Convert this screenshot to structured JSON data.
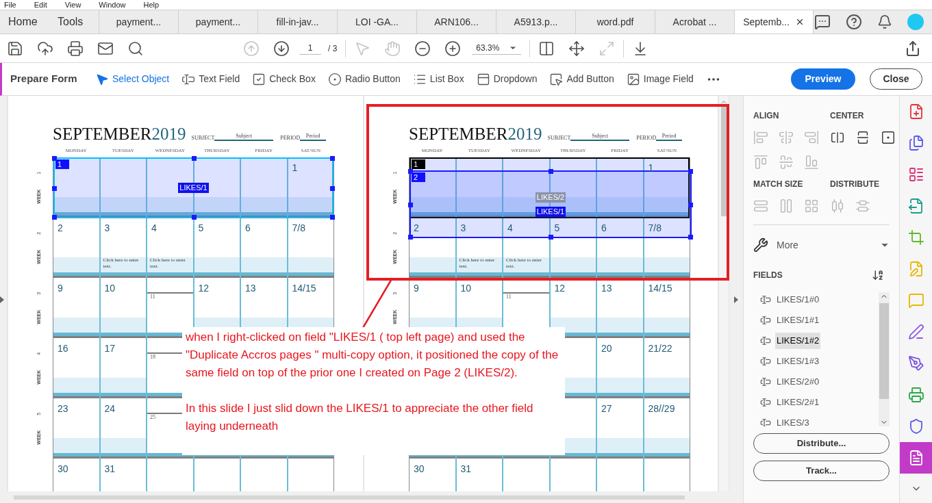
{
  "menu": [
    "File",
    "Edit",
    "View",
    "Window",
    "Help"
  ],
  "tabs": [
    {
      "label": "Home",
      "kind": "nav",
      "selected": false
    },
    {
      "label": "Tools",
      "kind": "nav",
      "selected": false
    },
    {
      "label": "payment...",
      "kind": "doc",
      "selected": false
    },
    {
      "label": "payment...",
      "kind": "doc",
      "selected": false
    },
    {
      "label": "fill-in-jav...",
      "kind": "doc",
      "selected": false
    },
    {
      "label": "LOI -GA...",
      "kind": "doc",
      "selected": false
    },
    {
      "label": "ARN106...",
      "kind": "doc",
      "selected": false
    },
    {
      "label": "A5913.p...",
      "kind": "doc",
      "selected": false
    },
    {
      "label": "word.pdf",
      "kind": "doc",
      "selected": false
    },
    {
      "label": "Acrobat ...",
      "kind": "doc",
      "selected": false
    },
    {
      "label": "Septemb...",
      "kind": "doc",
      "selected": true
    }
  ],
  "toolbar": {
    "left": [
      {
        "kind": "save",
        "disabled": false
      },
      {
        "kind": "upload",
        "disabled": false
      },
      {
        "kind": "print",
        "disabled": false
      },
      {
        "kind": "mail",
        "disabled": false
      },
      {
        "kind": "find",
        "disabled": false
      }
    ],
    "nav": [
      {
        "kind": "up",
        "disabled": true
      },
      {
        "kind": "down",
        "disabled": false
      }
    ],
    "page": {
      "value": "1",
      "total": "/ 3"
    },
    "view": [
      {
        "kind": "pointer",
        "disabled": true
      },
      {
        "kind": "hand",
        "disabled": true
      },
      {
        "kind": "zoom-out",
        "disabled": false
      },
      {
        "kind": "zoom-in",
        "disabled": false
      }
    ],
    "zoom": "63.3%",
    "fit": [
      {
        "kind": "fit-width",
        "disabled": false
      },
      {
        "kind": "fit-page",
        "disabled": false
      },
      {
        "kind": "fullscreen",
        "disabled": true
      }
    ],
    "extra": [
      {
        "kind": "reading",
        "disabled": false
      }
    ]
  },
  "form_bar": {
    "title": "Prepare Form",
    "tools": [
      {
        "kind": "select",
        "label": "Select Object",
        "selected": true
      },
      {
        "kind": "text",
        "label": "Text Field",
        "selected": false
      },
      {
        "kind": "checkbox",
        "label": "Check Box",
        "selected": false
      },
      {
        "kind": "radio",
        "label": "Radio Button",
        "selected": false
      },
      {
        "kind": "list",
        "label": "List Box",
        "selected": false
      },
      {
        "kind": "dropdown",
        "label": "Dropdown",
        "selected": false
      },
      {
        "kind": "button",
        "label": "Add Button",
        "selected": false
      },
      {
        "kind": "image",
        "label": "Image Field",
        "selected": false
      }
    ],
    "preview": "Preview",
    "close": "Close"
  },
  "pages": [
    {
      "month": "SEPTEMBER",
      "year": "2019",
      "subject_label": "SUBJECT",
      "subject_value": "Subject",
      "period_label": "PERIOD",
      "period_value": "Period",
      "days": [
        "MONDAY",
        "TUESDAY",
        "WEDNESDAY",
        "THURSDAY",
        "FRIDAY",
        "SAT/SUN"
      ],
      "weeks": [
        {
          "label": "WEEK",
          "number": "1",
          "cells": [
            {},
            {},
            {},
            {},
            {},
            {
              "date": "1"
            }
          ]
        },
        {
          "label": "WEEK",
          "number": "2",
          "cells": [
            {
              "date": "2"
            },
            {
              "date": "3",
              "note": "Click here to enter text."
            },
            {
              "date": "4",
              "note": "Click here to enter text."
            },
            {
              "date": "5"
            },
            {
              "date": "6"
            },
            {
              "date": "7/8"
            }
          ]
        },
        {
          "label": "WEEK",
          "number": "3",
          "cells": [
            {
              "date": "9"
            },
            {
              "date": "10"
            },
            {
              "small_date": "11"
            },
            {
              "date": "12"
            },
            {
              "date": "13"
            },
            {
              "date": "14/15"
            }
          ]
        },
        {
          "label": "WEEK",
          "number": "4",
          "cells": [
            {
              "date": "16"
            },
            {
              "date": "17"
            },
            {
              "small_date": "18"
            },
            {},
            {},
            {}
          ]
        },
        {
          "label": "WEEK",
          "number": "5",
          "cells": [
            {
              "date": "23"
            },
            {
              "date": "24"
            },
            {
              "small_date": "25"
            },
            {},
            {},
            {}
          ]
        },
        {
          "cells": [
            {
              "date": "30"
            },
            {
              "date": "31"
            },
            {},
            {},
            {},
            {}
          ]
        }
      ],
      "fields": [
        {
          "badge": "1",
          "kind": "in_place",
          "selected": true,
          "color": "#00c0ff",
          "labels": [
            {
              "text": "LIKES/1",
              "selected": true
            }
          ]
        }
      ]
    },
    {
      "month": "SEPTEMBER",
      "year": "2019",
      "subject_label": "SUBJECT",
      "subject_value": "Subject",
      "period_label": "PERIOD",
      "period_value": "Period",
      "days": [
        "MONDAY",
        "TUESDAY",
        "WEDNESDAY",
        "THURSDAY",
        "FRIDAY",
        "SAT/SUN"
      ],
      "weeks": [
        {
          "label": "WEEK",
          "number": "1",
          "cells": [
            {},
            {},
            {},
            {},
            {},
            {
              "date": "1"
            }
          ]
        },
        {
          "label": "WEEK",
          "number": "2",
          "cells": [
            {
              "date": "2"
            },
            {
              "date": "3",
              "note": "Click here to enter text."
            },
            {
              "date": "4",
              "note": "Click here to enter text."
            },
            {
              "date": "5"
            },
            {
              "date": "6"
            },
            {
              "date": "7/8"
            }
          ]
        },
        {
          "label": "WEEK",
          "number": "3",
          "cells": [
            {
              "date": "9"
            },
            {
              "date": "10"
            },
            {
              "small_date": "11"
            },
            {
              "date": "12"
            },
            {
              "date": "13"
            },
            {
              "date": "14/15"
            }
          ]
        },
        {
          "cells": [
            {},
            {},
            {},
            {},
            {
              "date": "20"
            },
            {
              "date": "21/22"
            }
          ]
        },
        {
          "cells": [
            {},
            {},
            {},
            {},
            {
              "date": "27"
            },
            {
              "date": "28//29"
            }
          ]
        },
        {
          "cells": [
            {
              "date": "30"
            },
            {
              "date": "31"
            },
            {},
            {},
            {},
            {}
          ]
        }
      ],
      "fields": [
        {
          "badge": "1",
          "kind": "in_place",
          "selected": false,
          "color": "#000000"
        },
        {
          "badge": "2",
          "kind": "moved_down",
          "selected": true,
          "color": "#1a1aff",
          "labels": [
            {
              "text": "LIKES/2",
              "selected": false
            },
            {
              "text": "LIKES/1",
              "selected": true
            }
          ]
        }
      ]
    }
  ],
  "annotation": {
    "paragraphs": [
      "when I right-clicked on field \"LIKES/1 ( top left page) and used the \"Duplicate Accros pages \" multi-copy option,  it positioned the copy of  the same field on top of the prior one I created on Page 2 (LIKES/2).",
      "In this slide I just slid down the LIKES/1 to appreciate the other field laying underneath"
    ]
  },
  "panel": {
    "groups": [
      {
        "title": "ALIGN",
        "tools": [
          {
            "kind": "align-left",
            "disabled": true
          },
          {
            "kind": "align-center",
            "disabled": true
          },
          {
            "kind": "align-right",
            "disabled": true
          },
          {
            "kind": "align-top",
            "disabled": true
          },
          {
            "kind": "align-middle",
            "disabled": true
          },
          {
            "kind": "align-bottom",
            "disabled": true
          }
        ]
      },
      {
        "title": "CENTER",
        "tools": [
          {
            "kind": "center-horizontal",
            "disabled": false
          },
          {
            "kind": "center-vertical",
            "disabled": false
          },
          {
            "kind": "center-both",
            "disabled": false
          }
        ]
      },
      {
        "title": "MATCH SIZE",
        "tools": [
          {
            "kind": "match-width",
            "disabled": true
          },
          {
            "kind": "match-height",
            "disabled": true
          },
          {
            "kind": "match-both",
            "disabled": true
          }
        ]
      },
      {
        "title": "DISTRIBUTE",
        "tools": [
          {
            "kind": "distribute-horizontal",
            "disabled": true
          },
          {
            "kind": "distribute-vertical",
            "disabled": true
          }
        ]
      }
    ],
    "more": "More",
    "fields_title": "FIELDS",
    "fields": [
      {
        "label": "LIKES/1#0",
        "selected": false
      },
      {
        "label": "LIKES/1#1",
        "selected": false
      },
      {
        "label": "LIKES/1#2",
        "selected": true
      },
      {
        "label": "LIKES/1#3",
        "selected": false
      },
      {
        "label": "LIKES/2#0",
        "selected": false
      },
      {
        "label": "LIKES/2#1",
        "selected": false
      },
      {
        "label": "LIKES/3",
        "selected": false
      }
    ],
    "buttons": [
      "Distribute...",
      "Track..."
    ]
  },
  "rail": [
    {
      "kind": "create",
      "color": "#e3343f",
      "selected": false
    },
    {
      "kind": "combine",
      "color": "#5a5aeb",
      "selected": false
    },
    {
      "kind": "organize",
      "color": "#e0307a",
      "selected": false
    },
    {
      "kind": "export",
      "color": "#1b9c8f",
      "selected": false
    },
    {
      "kind": "crop",
      "color": "#5dbb2b",
      "selected": false
    },
    {
      "kind": "edit",
      "color": "#e5b800",
      "selected": false
    },
    {
      "kind": "comment",
      "color": "#e5b800",
      "selected": false
    },
    {
      "kind": "sign",
      "color": "#8d5be0",
      "selected": false
    },
    {
      "kind": "fill",
      "color": "#7b55e0",
      "selected": false
    },
    {
      "kind": "print",
      "color": "#29a847",
      "selected": false
    },
    {
      "kind": "protect",
      "color": "#5a5aeb",
      "selected": false
    },
    {
      "kind": "form",
      "color": "#c13bc8",
      "selected": true
    }
  ]
}
